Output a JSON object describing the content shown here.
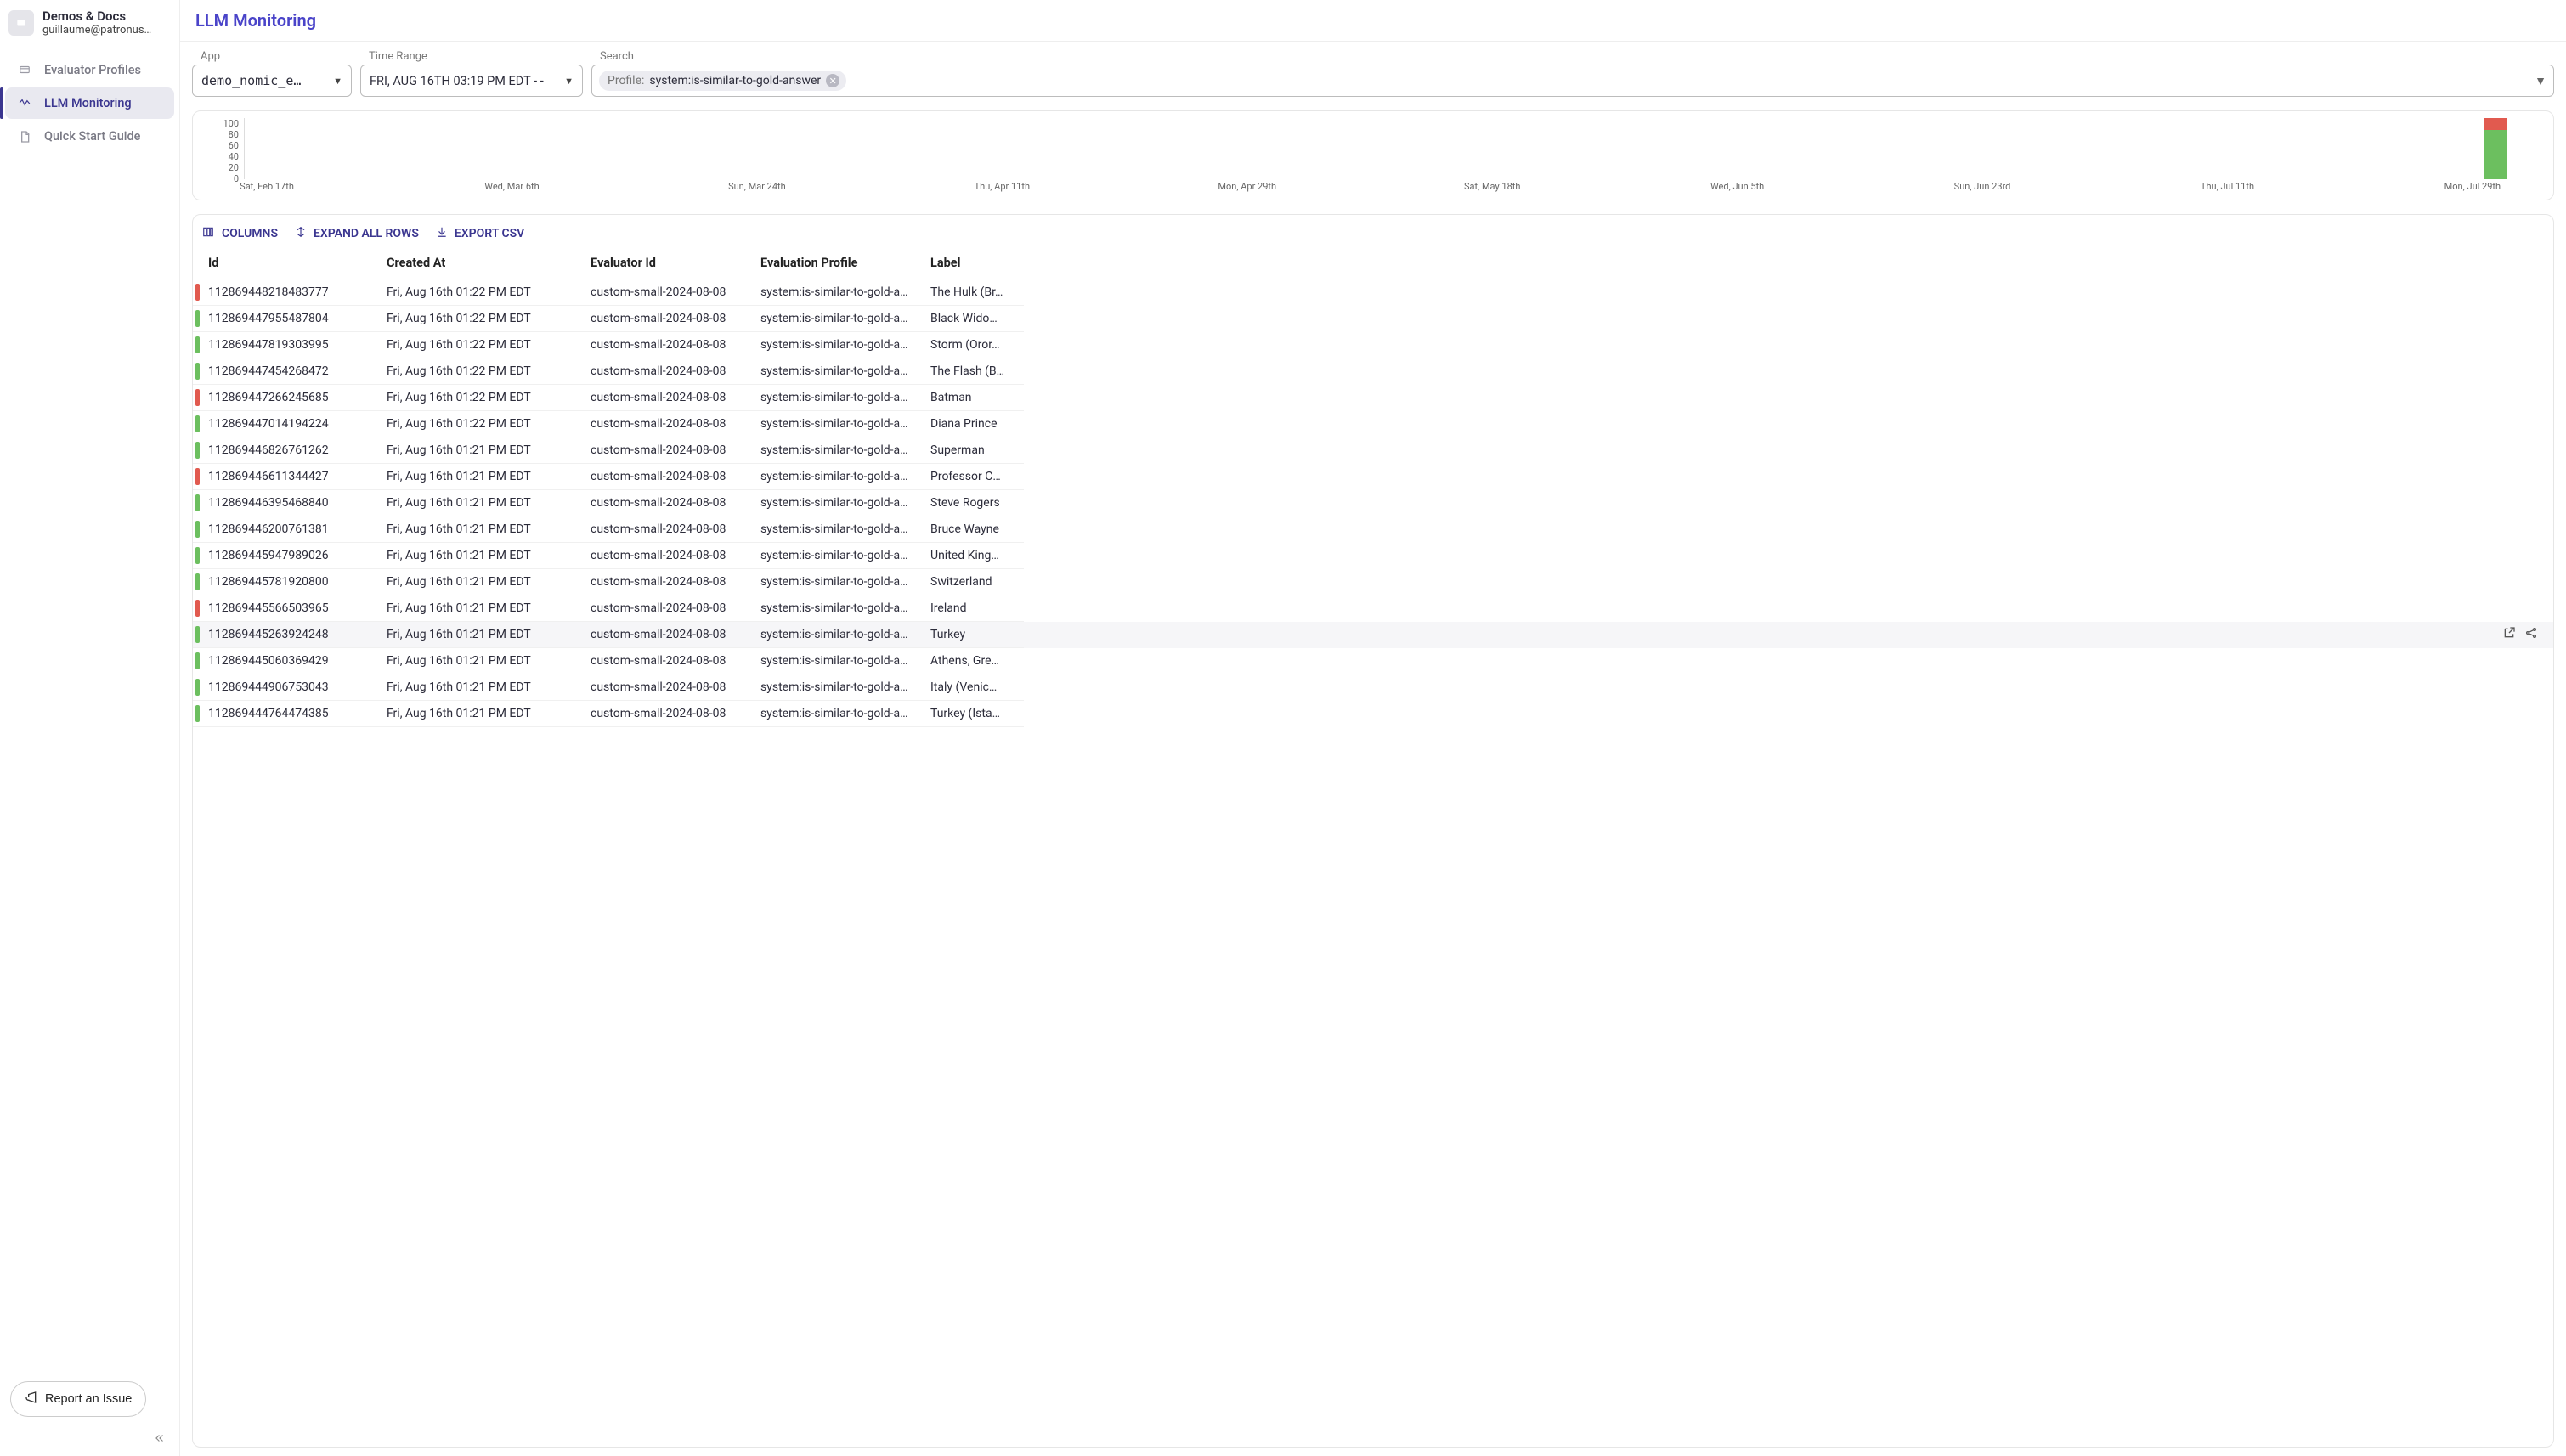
{
  "org": {
    "name": "Demos & Docs",
    "email": "guillaume@patronus…"
  },
  "nav": {
    "items": [
      {
        "label": "Evaluator Profiles"
      },
      {
        "label": "LLM Monitoring"
      },
      {
        "label": "Quick Start Guide"
      }
    ],
    "report": "Report an Issue"
  },
  "page": {
    "title": "LLM Monitoring"
  },
  "filters": {
    "app_label": "App",
    "app_value": "demo_nomic_e…",
    "time_label": "Time Range",
    "time_value": "FRI, AUG 16TH 03:19 PM EDT - -",
    "search_label": "Search",
    "chip_prefix": "Profile:",
    "chip_value": "system:is-similar-to-gold-answer"
  },
  "chart_data": {
    "type": "bar",
    "ylim": [
      0,
      100
    ],
    "yticks": [
      100,
      80,
      60,
      40,
      20,
      0
    ],
    "xticks": [
      "Sat, Feb 17th",
      "Wed, Mar 6th",
      "Sun, Mar 24th",
      "Thu, Apr 11th",
      "Mon, Apr 29th",
      "Sat, May 18th",
      "Wed, Jun 5th",
      "Sun, Jun 23rd",
      "Thu, Jul 11th",
      "Mon, Jul 29th"
    ],
    "series": [
      {
        "name": "pass",
        "color": "#6cbf5f",
        "values": [
          0,
          0,
          0,
          0,
          0,
          0,
          0,
          0,
          0,
          0,
          80
        ]
      },
      {
        "name": "fail",
        "color": "#e15a4f",
        "values": [
          0,
          0,
          0,
          0,
          0,
          0,
          0,
          0,
          0,
          0,
          20
        ]
      }
    ],
    "bar_index_count": 11
  },
  "toolbar": {
    "columns": "COLUMNS",
    "expand": "EXPAND ALL ROWS",
    "export": "EXPORT CSV"
  },
  "table": {
    "headers": [
      "Id",
      "Created At",
      "Evaluator Id",
      "Evaluation Profile",
      "Label"
    ],
    "rows": [
      {
        "status": "fail",
        "id": "112869448218483777",
        "created": "Fri, Aug 16th 01:22 PM EDT",
        "evaluator": "custom-small-2024-08-08",
        "profile": "system:is-similar-to-gold-a…",
        "label": "The Hulk (Br…"
      },
      {
        "status": "pass",
        "id": "112869447955487804",
        "created": "Fri, Aug 16th 01:22 PM EDT",
        "evaluator": "custom-small-2024-08-08",
        "profile": "system:is-similar-to-gold-a…",
        "label": "Black Wido…"
      },
      {
        "status": "pass",
        "id": "112869447819303995",
        "created": "Fri, Aug 16th 01:22 PM EDT",
        "evaluator": "custom-small-2024-08-08",
        "profile": "system:is-similar-to-gold-a…",
        "label": "Storm (Oror…"
      },
      {
        "status": "pass",
        "id": "112869447454268472",
        "created": "Fri, Aug 16th 01:22 PM EDT",
        "evaluator": "custom-small-2024-08-08",
        "profile": "system:is-similar-to-gold-a…",
        "label": "The Flash (B…"
      },
      {
        "status": "fail",
        "id": "112869447266245685",
        "created": "Fri, Aug 16th 01:22 PM EDT",
        "evaluator": "custom-small-2024-08-08",
        "profile": "system:is-similar-to-gold-a…",
        "label": "Batman"
      },
      {
        "status": "pass",
        "id": "112869447014194224",
        "created": "Fri, Aug 16th 01:22 PM EDT",
        "evaluator": "custom-small-2024-08-08",
        "profile": "system:is-similar-to-gold-a…",
        "label": "Diana Prince"
      },
      {
        "status": "pass",
        "id": "112869446826761262",
        "created": "Fri, Aug 16th 01:21 PM EDT",
        "evaluator": "custom-small-2024-08-08",
        "profile": "system:is-similar-to-gold-a…",
        "label": "Superman"
      },
      {
        "status": "fail",
        "id": "112869446611344427",
        "created": "Fri, Aug 16th 01:21 PM EDT",
        "evaluator": "custom-small-2024-08-08",
        "profile": "system:is-similar-to-gold-a…",
        "label": "Professor C…"
      },
      {
        "status": "pass",
        "id": "112869446395468840",
        "created": "Fri, Aug 16th 01:21 PM EDT",
        "evaluator": "custom-small-2024-08-08",
        "profile": "system:is-similar-to-gold-a…",
        "label": "Steve Rogers"
      },
      {
        "status": "pass",
        "id": "112869446200761381",
        "created": "Fri, Aug 16th 01:21 PM EDT",
        "evaluator": "custom-small-2024-08-08",
        "profile": "system:is-similar-to-gold-a…",
        "label": "Bruce Wayne"
      },
      {
        "status": "pass",
        "id": "112869445947989026",
        "created": "Fri, Aug 16th 01:21 PM EDT",
        "evaluator": "custom-small-2024-08-08",
        "profile": "system:is-similar-to-gold-a…",
        "label": "United King…"
      },
      {
        "status": "pass",
        "id": "112869445781920800",
        "created": "Fri, Aug 16th 01:21 PM EDT",
        "evaluator": "custom-small-2024-08-08",
        "profile": "system:is-similar-to-gold-a…",
        "label": "Switzerland"
      },
      {
        "status": "fail",
        "id": "112869445566503965",
        "created": "Fri, Aug 16th 01:21 PM EDT",
        "evaluator": "custom-small-2024-08-08",
        "profile": "system:is-similar-to-gold-a…",
        "label": "Ireland"
      },
      {
        "status": "pass",
        "id": "112869445263924248",
        "created": "Fri, Aug 16th 01:21 PM EDT",
        "evaluator": "custom-small-2024-08-08",
        "profile": "system:is-similar-to-gold-a…",
        "label": "Turkey",
        "hover": true
      },
      {
        "status": "pass",
        "id": "112869445060369429",
        "created": "Fri, Aug 16th 01:21 PM EDT",
        "evaluator": "custom-small-2024-08-08",
        "profile": "system:is-similar-to-gold-a…",
        "label": "Athens, Gre…"
      },
      {
        "status": "pass",
        "id": "112869444906753043",
        "created": "Fri, Aug 16th 01:21 PM EDT",
        "evaluator": "custom-small-2024-08-08",
        "profile": "system:is-similar-to-gold-a…",
        "label": "Italy (Venic…"
      },
      {
        "status": "pass",
        "id": "112869444764474385",
        "created": "Fri, Aug 16th 01:21 PM EDT",
        "evaluator": "custom-small-2024-08-08",
        "profile": "system:is-similar-to-gold-a…",
        "label": "Turkey (Ista…"
      }
    ]
  },
  "colors": {
    "pass": "#6cbf5f",
    "fail": "#e15a4f"
  }
}
